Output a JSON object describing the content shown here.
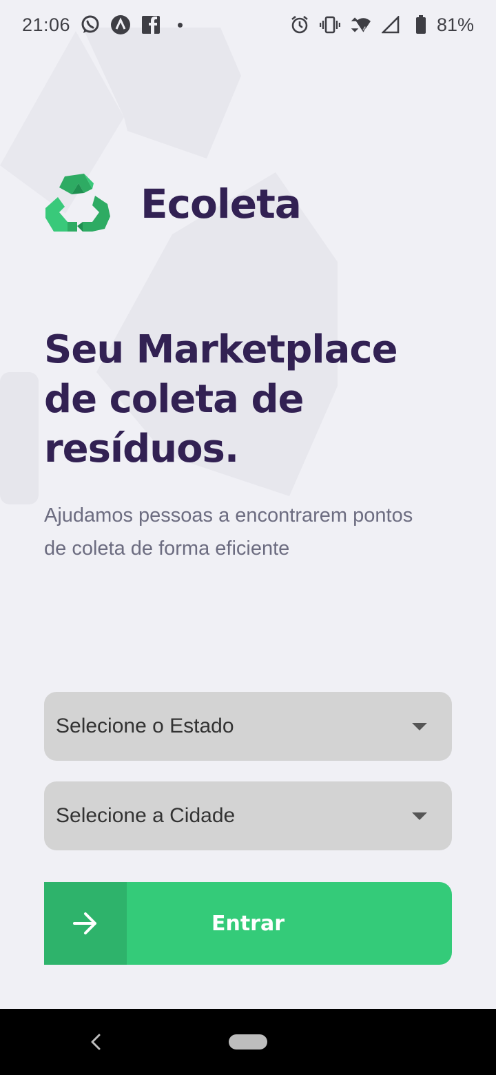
{
  "status_bar": {
    "time": "21:06",
    "battery": "81%",
    "left_icons": [
      "whatsapp-icon",
      "app-icon",
      "facebook-icon",
      "dot-icon"
    ],
    "right_icons": [
      "alarm-icon",
      "vibrate-icon",
      "wifi-icon",
      "signal-icon",
      "battery-icon"
    ]
  },
  "brand": {
    "name": "Ecoleta",
    "icon": "recycle-icon",
    "color": "#322153",
    "accent": "#34CB79"
  },
  "hero": {
    "title": "Seu Marketplace de coleta de resíduos.",
    "description": "Ajudamos pessoas a encontrarem pontos de coleta de forma eficiente"
  },
  "form": {
    "state_select": {
      "placeholder": "Selecione o Estado"
    },
    "city_select": {
      "placeholder": "Selecione a Cidade"
    },
    "submit": {
      "label": "Entrar",
      "icon": "arrow-right-icon"
    }
  },
  "nav_bar": {
    "buttons": [
      "back-icon",
      "home-pill-icon"
    ]
  }
}
